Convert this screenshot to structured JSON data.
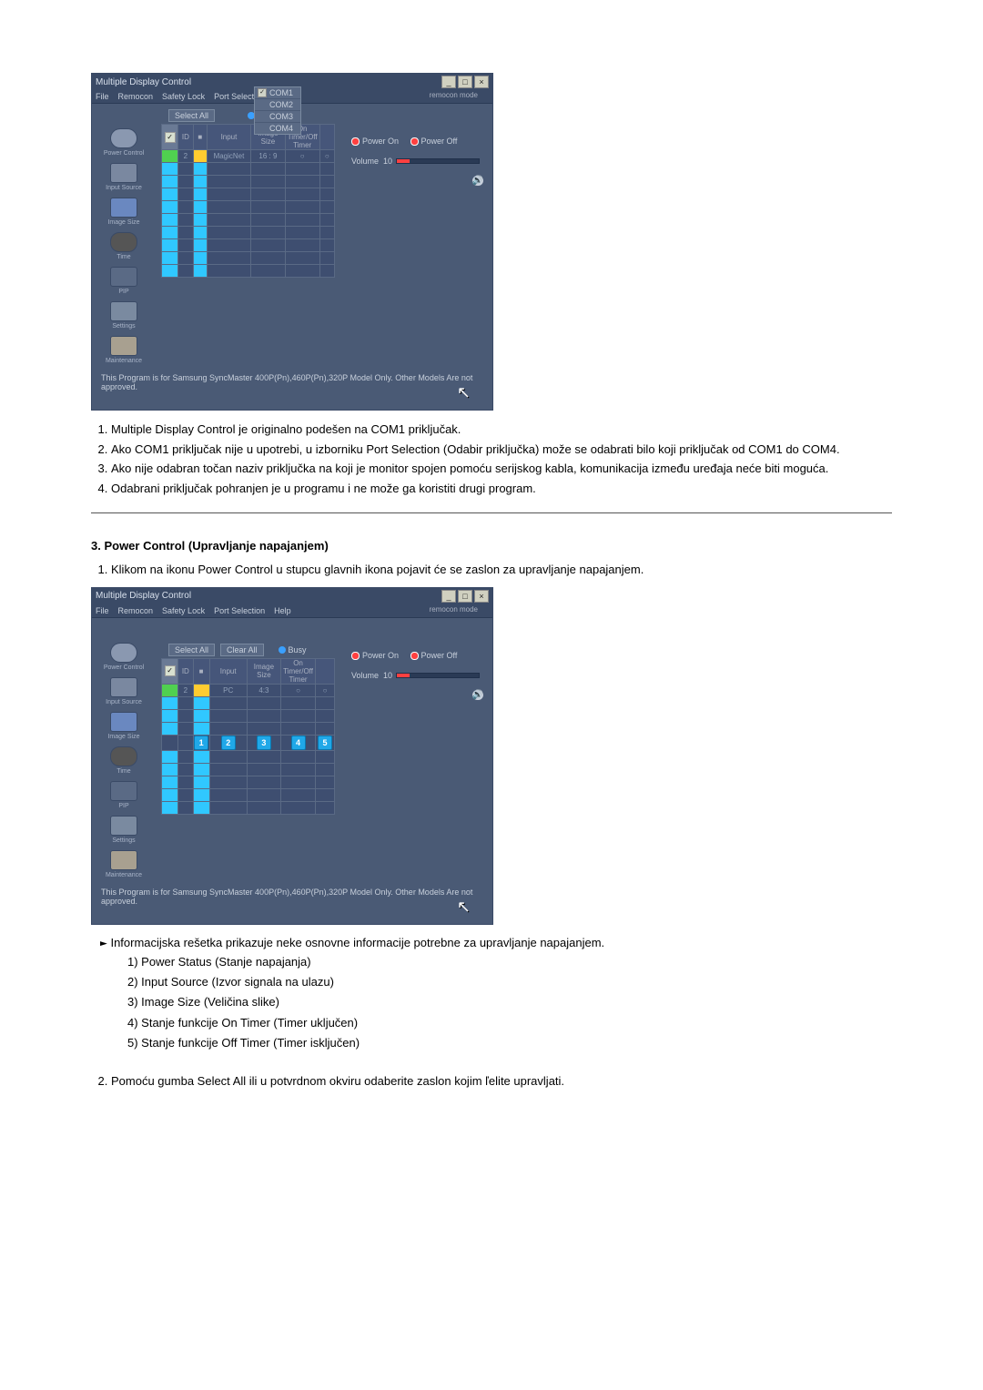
{
  "app": {
    "title": "Multiple Display Control",
    "menus": [
      "File",
      "Remocon",
      "Safety Lock",
      "Port Selection",
      "Help"
    ],
    "remocon_indicator": "remocon mode",
    "port_options": [
      "COM1",
      "COM2",
      "COM3",
      "COM4"
    ],
    "port_checked_index": 0,
    "toolbar": {
      "select_all": "Select All",
      "clear_all": "Clear All",
      "busy": "Busy"
    },
    "grid_headers": {
      "sel": "✓",
      "id": "ID",
      "power": "■",
      "input": "Input",
      "size": "Image Size",
      "on_off_timer": "On Timer/Off Timer"
    },
    "grid_first_row": {
      "id": "2",
      "input1": "MagicNet",
      "size1": "16 : 9",
      "input2": "PC",
      "size2": "4:3",
      "ot": "○",
      "ft": "○"
    },
    "right": {
      "power_on": "Power On",
      "power_off": "Power Off",
      "volume_label": "Volume",
      "volume_value": "10"
    },
    "footer": "This Program is for Samsung SyncMaster 400P(Pn),460P(Pn),320P  Model Only. Other Models Are not approved.",
    "sidebar": [
      "Power Control",
      "Input Source",
      "Image Size",
      "Time",
      "PIP",
      "Settings",
      "Maintenance"
    ]
  },
  "callouts": [
    "1",
    "2",
    "3",
    "4",
    "5"
  ],
  "text": {
    "list1": {
      "i1": "Multiple Display Control je originalno podešen na COM1 priključak.",
      "i2": "Ako COM1 priključak nije u upotrebi, u izborniku Port Selection (Odabir priključka) može se odabrati bilo koji priključak od COM1 do COM4.",
      "i3": "Ako nije odabran točan naziv priključka na koji je monitor spojen pomoću serijskog kabla, komunikacija između uređaja neće biti moguća.",
      "i4": "Odabrani priključak pohranjen je u programu i ne može ga koristiti drugi program."
    },
    "section3_title": "3. Power Control (Upravljanje napajanjem)",
    "list2": {
      "i1": "Klikom na ikonu Power Control u stupcu glavnih ikona pojavit će se zaslon za upravljanje napajanjem."
    },
    "bullet_intro": "Informacijska rešetka prikazuje neke osnovne informacije potrebne za upravljanje napajanjem.",
    "sub": {
      "s1": "1) Power Status (Stanje napajanja)",
      "s2": "2) Input Source (Izvor signala na ulazu)",
      "s3": "3) Image Size (Veličina slike)",
      "s4": "4) Stanje funkcije On Timer (Timer uključen)",
      "s5": "5) Stanje funkcije Off Timer (Timer isključen)"
    },
    "list3": {
      "i2": "Pomoću gumba Select All ili u potvrdnom okviru odaberite zaslon kojim ľelite upravljati."
    }
  }
}
